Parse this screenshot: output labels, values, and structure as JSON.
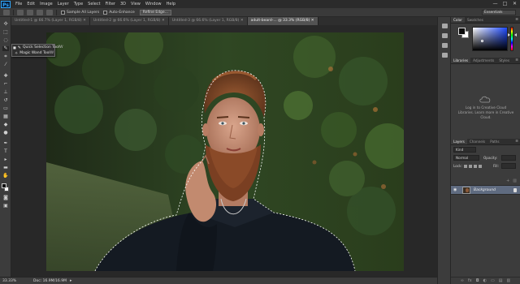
{
  "menu": {
    "logo": "Ps",
    "items": [
      "File",
      "Edit",
      "Image",
      "Layer",
      "Type",
      "Select",
      "Filter",
      "3D",
      "View",
      "Window",
      "Help"
    ],
    "window_controls": [
      "—",
      "□",
      "✕"
    ]
  },
  "options_bar": {
    "sample_all_layers": "Sample All Layers",
    "auto_enhance": "Auto-Enhance",
    "refine_edge": "Refine Edge...",
    "workspace": "Essentials"
  },
  "tabs": [
    {
      "label": "Untitled-1 @ 66.7% (Layer 1, RGB/8) ✕",
      "active": false
    },
    {
      "label": "Untitled-2 @ 66.6% (Layer 1, RGB/8) ✕",
      "active": false
    },
    {
      "label": "Untitled-3 @ 66.6% (Layer 1, RGB/8) ✕",
      "active": false
    },
    {
      "label": "adult-beard-... @ 33.3% (RGB/8) ✕",
      "active": true
    }
  ],
  "flyout": {
    "items": [
      {
        "label": "Quick Selection Tool",
        "key": "W",
        "selected": true
      },
      {
        "label": "Magic Wand Tool",
        "key": "W",
        "selected": false
      }
    ]
  },
  "status": {
    "zoom": "33.33%",
    "doc": "Doc: 16.9M/16.9M"
  },
  "panels": {
    "color_tabs": [
      "Color",
      "Swatches"
    ],
    "library_tabs": [
      "Libraries",
      "Adjustments",
      "Styles"
    ],
    "library_message": "Log in to Creative Cloud Libraries. Learn more in Creative Cloud.",
    "layers_tabs": [
      "Layers",
      "Channels",
      "Paths"
    ],
    "kind": "Kind",
    "blend_mode": "Normal",
    "opacity_label": "Opacity:",
    "lock_label": "Lock:",
    "fill_label": "Fill:",
    "layer_name": "Background"
  },
  "colors": {
    "foreground": "#0c0c0c",
    "background": "#ffffff",
    "layer_selected": "#5f6b80"
  }
}
